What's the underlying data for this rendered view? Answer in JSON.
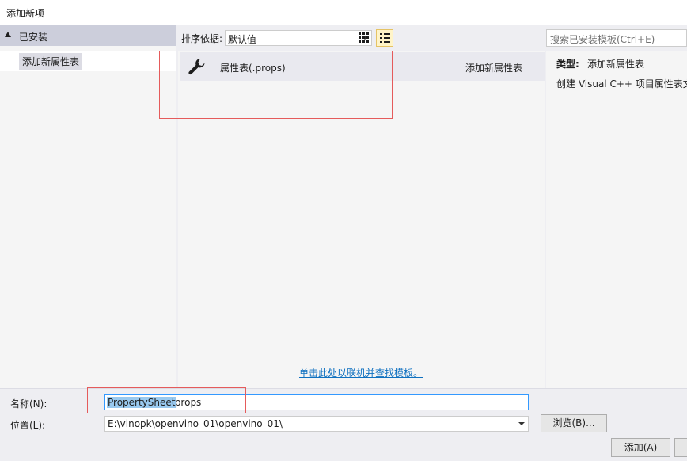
{
  "window": {
    "title": "添加新项"
  },
  "tree": {
    "header": "已安装",
    "items": [
      {
        "label": "添加新属性表"
      }
    ]
  },
  "toolbar": {
    "sort_label": "排序依据:",
    "sort_value": "默认值"
  },
  "templates": [
    {
      "name": "属性表(.props)",
      "type": "添加新属性表",
      "icon": "wrench-icon"
    }
  ],
  "online_link": "单击此处以联机并查找模板。",
  "search": {
    "placeholder": "搜索已安装模板(Ctrl+E)"
  },
  "detail": {
    "type_key": "类型:",
    "type_value": "添加新属性表",
    "description": "创建 Visual C++ 项目属性表文"
  },
  "form": {
    "name_label": "名称(N):",
    "name_selected": "PropertySheet",
    "name_rest": ".props",
    "location_label": "位置(L):",
    "location_value": "E:\\vinopk\\openvino_01\\openvino_01\\",
    "browse_label": "浏览(B)...",
    "add_label": "添加(A)"
  },
  "colors": {
    "accent": "#0e70c0",
    "highlight_box": "#e55b5b",
    "selection": "#99c9ef"
  }
}
